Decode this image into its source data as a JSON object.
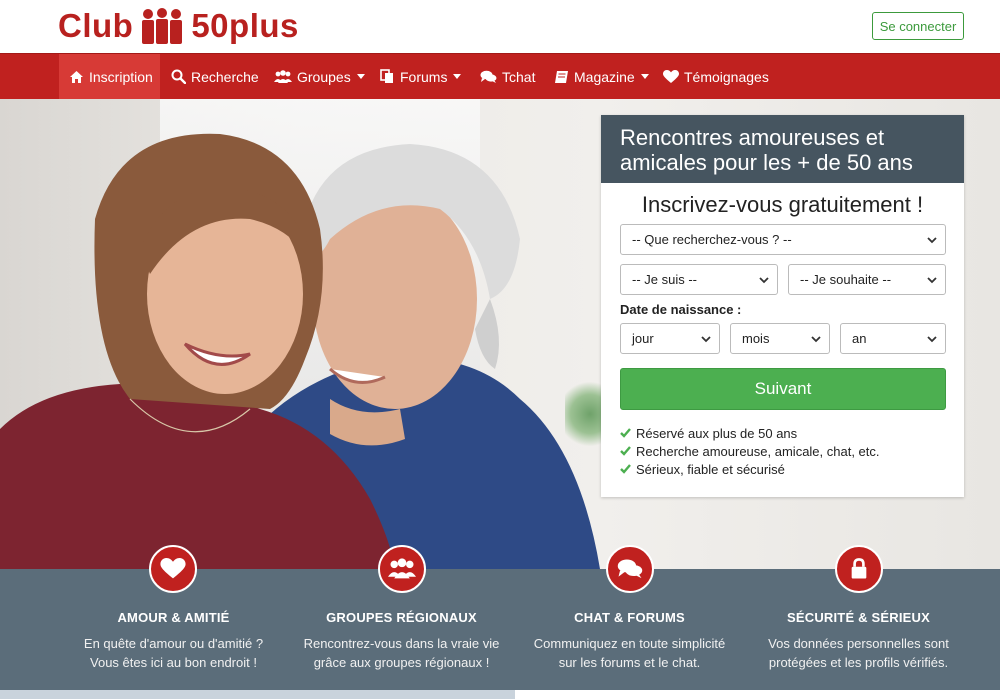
{
  "brand": {
    "name_part1": "Club",
    "name_part2": "50plus",
    "color": "#b8211f"
  },
  "header": {
    "login_label": "Se connecter"
  },
  "nav": {
    "items": [
      {
        "label": "Inscription",
        "icon": "home-icon",
        "active": true,
        "dropdown": false
      },
      {
        "label": "Recherche",
        "icon": "search-icon",
        "dropdown": false
      },
      {
        "label": "Groupes",
        "icon": "users-icon",
        "dropdown": true
      },
      {
        "label": "Forums",
        "icon": "copy-icon",
        "dropdown": true
      },
      {
        "label": "Tchat",
        "icon": "comments-icon",
        "dropdown": false
      },
      {
        "label": "Magazine",
        "icon": "book-icon",
        "dropdown": true
      },
      {
        "label": "Témoignages",
        "icon": "heart-icon",
        "dropdown": false
      }
    ],
    "color": "#c0211f"
  },
  "signup": {
    "heading": "Rencontres amoureuses et amicales pour les + de 50 ans",
    "subheading": "Inscrivez-vous gratuitement !",
    "looking_for": "-- Que recherchez-vous ? --",
    "i_am": "-- Je suis --",
    "i_want": "-- Je souhaite --",
    "dob_label": "Date de naissance :",
    "day": "jour",
    "month": "mois",
    "year": "an",
    "next_label": "Suivant",
    "checks": [
      "Réservé aux plus de 50 ans",
      "Recherche amoureuse, amicale, chat, etc.",
      "Sérieux, fiable et sécurisé"
    ]
  },
  "features": [
    {
      "title": "AMOUR & AMITIÉ",
      "text1": "En quête d'amour ou d'amitié ?",
      "text2": "Vous êtes ici au bon endroit !",
      "icon": "heart-icon"
    },
    {
      "title": "GROUPES RÉGIONAUX",
      "text1": "Rencontrez-vous dans la vraie vie",
      "text2": "grâce aux groupes régionaux !",
      "icon": "users-icon"
    },
    {
      "title": "CHAT & FORUMS",
      "text1": "Communiquez en toute simplicité",
      "text2": "sur les forums et le chat.",
      "icon": "comments-icon"
    },
    {
      "title": "SÉCURITÉ & SÉRIEUX",
      "text1": "Vos données personnelles sont",
      "text2": "protégées et les profils vérifiés.",
      "icon": "lock-icon"
    }
  ]
}
